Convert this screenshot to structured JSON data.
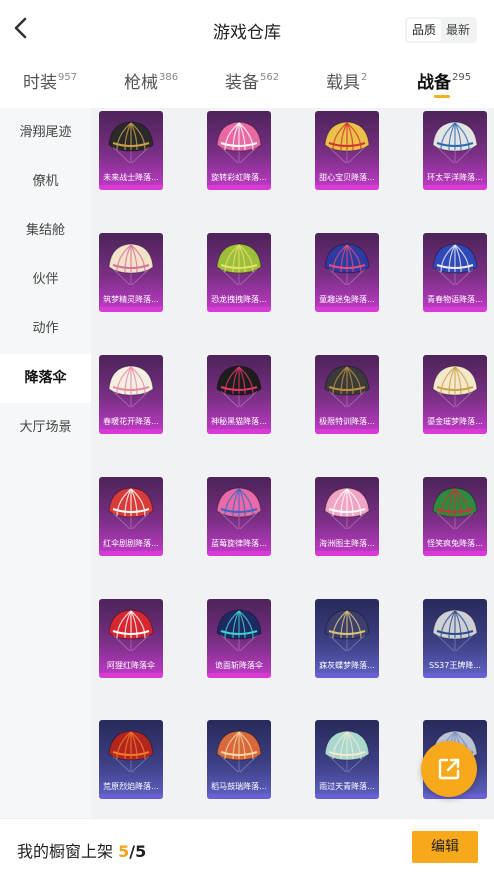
{
  "header": {
    "title": "游戏仓库",
    "sort_options": [
      "品质",
      "最新"
    ],
    "sort_selected": "品质"
  },
  "tabs": [
    {
      "label": "时装",
      "count": "957",
      "active": false
    },
    {
      "label": "枪械",
      "count": "386",
      "active": false
    },
    {
      "label": "装备",
      "count": "562",
      "active": false
    },
    {
      "label": "载具",
      "count": "2",
      "active": false
    },
    {
      "label": "战备",
      "count": "295",
      "active": true
    }
  ],
  "sidebar": {
    "items": [
      {
        "label": "滑翔尾迹",
        "active": false
      },
      {
        "label": "僚机",
        "active": false
      },
      {
        "label": "集结舱",
        "active": false
      },
      {
        "label": "伙伴",
        "active": false
      },
      {
        "label": "动作",
        "active": false
      },
      {
        "label": "降落伞",
        "active": true
      },
      {
        "label": "大厅场景",
        "active": false
      }
    ]
  },
  "items": [
    {
      "label": "未来战士降落...",
      "rarity": "purple",
      "canopy": "#2a2a2a",
      "accent": "#c9a24a"
    },
    {
      "label": "旋转彩虹降落...",
      "rarity": "purple",
      "canopy": "#e96aa3",
      "accent": "#ffffff"
    },
    {
      "label": "甜心宝贝降落...",
      "rarity": "purple",
      "canopy": "#e9c14b",
      "accent": "#d2352f"
    },
    {
      "label": "环太平洋降落...",
      "rarity": "purple",
      "canopy": "#e4e4e4",
      "accent": "#2a6bb0"
    },
    {
      "label": "筑梦精灵降落...",
      "rarity": "purple",
      "canopy": "#f1e2c8",
      "accent": "#d96fa0"
    },
    {
      "label": "恐龙拽拽降落...",
      "rarity": "purple",
      "canopy": "#9cbf3a",
      "accent": "#e7e06a"
    },
    {
      "label": "童趣迷兔降落...",
      "rarity": "purple",
      "canopy": "#2d3aa1",
      "accent": "#e04f7a"
    },
    {
      "label": "青春物语降落...",
      "rarity": "purple",
      "canopy": "#2f49b8",
      "accent": "#eeeeee"
    },
    {
      "label": "春暖花开降落...",
      "rarity": "purple",
      "canopy": "#f4efe3",
      "accent": "#e98aa6"
    },
    {
      "label": "神秘黑猫降落...",
      "rarity": "purple",
      "canopy": "#1d1d1d",
      "accent": "#e23a6c"
    },
    {
      "label": "极限特训降落...",
      "rarity": "purple",
      "canopy": "#3a3a3a",
      "accent": "#b9913f"
    },
    {
      "label": "鎏金璀梦降落...",
      "rarity": "purple",
      "canopy": "#f3e7cc",
      "accent": "#c9a24a"
    },
    {
      "label": "红伞剧剧降落...",
      "rarity": "purple",
      "canopy": "#d93c38",
      "accent": "#ffffff"
    },
    {
      "label": "蓝莓旋律降落...",
      "rarity": "purple",
      "canopy": "#e86aa6",
      "accent": "#3a66c9"
    },
    {
      "label": "海洲图主降落...",
      "rarity": "purple",
      "canopy": "#f2a4c4",
      "accent": "#ffffff"
    },
    {
      "label": "怪笑疯兔降落...",
      "rarity": "purple",
      "canopy": "#2e8b3e",
      "accent": "#c8343a"
    },
    {
      "label": "阿狸红降落伞",
      "rarity": "purple",
      "canopy": "#d6262f",
      "accent": "#ffffff"
    },
    {
      "label": "诡面斩降落伞",
      "rarity": "purple",
      "canopy": "#1e2a66",
      "accent": "#3fd2c8"
    },
    {
      "label": "寐灰蝶梦降落...",
      "rarity": "blue",
      "canopy": "#3b3f6e",
      "accent": "#e0c27a"
    },
    {
      "label": "SS37王牌降...",
      "rarity": "blue",
      "canopy": "#cfcfd6",
      "accent": "#2d4d8a"
    },
    {
      "label": "荒原烈焰降落...",
      "rarity": "blue",
      "canopy": "#b3261e",
      "accent": "#f07a2a"
    },
    {
      "label": "稻马鼓瑞降落...",
      "rarity": "blue",
      "canopy": "#d9693a",
      "accent": "#f4d6a5"
    },
    {
      "label": "雨过天青降落...",
      "rarity": "blue",
      "canopy": "#a9d8cf",
      "accent": "#f2e9d2"
    },
    {
      "label": "",
      "rarity": "blue",
      "canopy": "#b9c4d8",
      "accent": "#7a8fc0"
    }
  ],
  "footer": {
    "shelf_label": "我的橱窗上架",
    "shelf_count": "5",
    "shelf_total": "/5",
    "edit_label": "编辑"
  },
  "fab": {
    "icon": "share-external-icon"
  },
  "colors": {
    "accent": "#f7a81b",
    "tab_underline": "#f5b021",
    "purple_rarity": "#d93ad6",
    "blue_rarity": "#6a5fd3"
  }
}
